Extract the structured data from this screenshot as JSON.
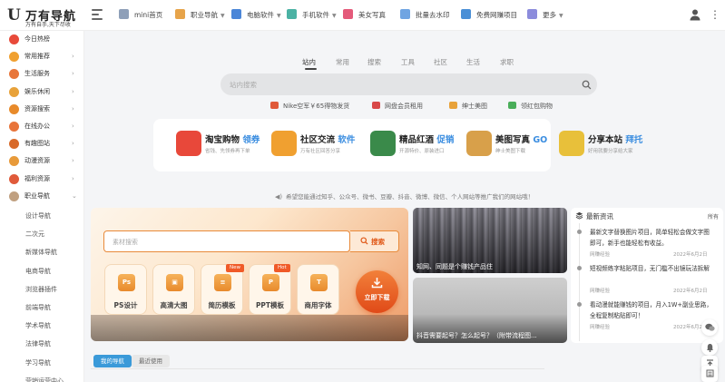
{
  "brand": {
    "mark": "U",
    "title": "万有导航",
    "slogan": "万有自手,天下尽收"
  },
  "topnav": [
    {
      "label": "mini首页",
      "icon": "home-icon",
      "color": "#8e9fb8",
      "dropdown": false
    },
    {
      "label": "职业导航",
      "icon": "briefcase-icon",
      "color": "#e7a44a",
      "dropdown": true
    },
    {
      "label": "电脑软件",
      "icon": "computer-icon",
      "color": "#4b86d8",
      "dropdown": true
    },
    {
      "label": "手机软件",
      "icon": "phone-icon",
      "color": "#4bb2a4",
      "dropdown": true
    },
    {
      "label": "美女写真",
      "icon": "heart-icon",
      "color": "#e45a7a",
      "dropdown": false
    },
    {
      "label": "批量去水印",
      "icon": "watermark-icon",
      "color": "#6fa4e2",
      "dropdown": false
    },
    {
      "label": "免费网赚项目",
      "icon": "money-icon",
      "color": "#4a8fd6",
      "dropdown": false
    },
    {
      "label": "更多",
      "icon": "grid-icon",
      "color": "#8c8cdc",
      "dropdown": true
    }
  ],
  "sidebar": {
    "items": [
      {
        "label": "今日热榜",
        "icon": "fire-icon",
        "color": "#e84a3a",
        "arrow": false
      },
      {
        "label": "常用推荐",
        "icon": "star-icon",
        "color": "#f0a030",
        "arrow": true
      },
      {
        "label": "生活服务",
        "icon": "life-icon",
        "color": "#e8763a",
        "arrow": true
      },
      {
        "label": "娱乐休闲",
        "icon": "smile-icon",
        "color": "#e8a23a",
        "arrow": true
      },
      {
        "label": "资源搜索",
        "icon": "search-icon",
        "color": "#e88a2a",
        "arrow": true
      },
      {
        "label": "在线办公",
        "icon": "office-icon",
        "color": "#e8743a",
        "arrow": true
      },
      {
        "label": "有趣图站",
        "icon": "image-icon",
        "color": "#d86a2a",
        "arrow": true
      },
      {
        "label": "动漫资源",
        "icon": "anime-icon",
        "color": "#e89a3a",
        "arrow": true
      },
      {
        "label": "福利资源",
        "icon": "gift-icon",
        "color": "#e05a3a",
        "arrow": true
      },
      {
        "label": "职业导航",
        "icon": "career-icon",
        "color": "#c0a080",
        "arrow": true
      }
    ],
    "subitems": [
      "设计导航",
      "二次元",
      "新媒体导航",
      "电商导航",
      "浏览器插件",
      "前端导航",
      "学术导航",
      "法律导航",
      "学习导航",
      "营销运营中心"
    ]
  },
  "search": {
    "tabs": [
      "站内",
      "常用",
      "搜索",
      "工具",
      "社区",
      "生活",
      "求职"
    ],
    "active_tab": 0,
    "placeholder": "站内搜索"
  },
  "hot_links": [
    {
      "label": "Nike空军￥65得物发货",
      "color": "#e05a3a"
    },
    {
      "label": "网盘会员租用",
      "color": "#d84848"
    },
    {
      "label": "绅士美图",
      "color": "#e8a23a"
    },
    {
      "label": "领红包购物",
      "color": "#4aae5a"
    }
  ],
  "features": [
    {
      "title": "淘宝购物",
      "tag": "领券",
      "sub": "省钱、先领券再下单",
      "icon": "coupon-icon",
      "color": "#e8483a"
    },
    {
      "title": "社区交流",
      "tag": "软件",
      "sub": "万有社区回答分享",
      "icon": "flame-icon",
      "color": "#f0a030"
    },
    {
      "title": "精品红酒",
      "tag": "促销",
      "sub": "开源特价、原装进口",
      "icon": "wine-icon",
      "color": "#3a8a4a"
    },
    {
      "title": "美图写真",
      "tag": "GO",
      "sub": "绅士美图下载",
      "icon": "photo-icon",
      "color": "#d8a04a"
    },
    {
      "title": "分享本站",
      "tag": "拜托",
      "sub": "好用就要分享给大家",
      "icon": "thumb-icon",
      "color": "#e8c03a"
    }
  ],
  "notice": "希望您能通过知乎、公众号、微书、豆瓣、抖音、微博、微信、个人网站等推广我们的网站哦！",
  "banner": {
    "input_placeholder": "素材搜索",
    "search_label": "搜索",
    "tools": [
      {
        "label": "PS设计",
        "glyph": "Ps",
        "badge": ""
      },
      {
        "label": "高清大图",
        "glyph": "▣",
        "badge": ""
      },
      {
        "label": "简历模板",
        "glyph": "≡",
        "badge": "New"
      },
      {
        "label": "PPT模板",
        "glyph": "P",
        "badge": "Hot"
      },
      {
        "label": "商用字体",
        "glyph": "T",
        "badge": ""
      }
    ],
    "download_label": "立即下载"
  },
  "image_cards": [
    {
      "caption": "知网、同题是个赚钱产品住"
    },
    {
      "caption": "抖音需要起号？怎么起号？（附带流程图..."
    }
  ],
  "news": {
    "title": "最新资讯",
    "all_label": "所有",
    "items": [
      {
        "text": "最新文字替换图片项目，简单轻松会做文字图即可，新手也能轻松有收益。",
        "source": "网赚经验",
        "date": "2022年6月2日"
      },
      {
        "text": "短视频练字粘贴项目，无门槛不出镜玩法拆解",
        "source": "网赚经验",
        "date": "2022年6月2日"
      },
      {
        "text": "看动漫就能赚钱的项目，月入1W+副业思路，全程复制粘贴即可！",
        "source": "网赚经验",
        "date": "2022年6月2日"
      }
    ]
  },
  "bottom_tabs": [
    "我的导航",
    "最近使用"
  ],
  "float_buttons": [
    "wechat-icon",
    "bell-icon",
    "top-icon",
    "list-icon"
  ]
}
